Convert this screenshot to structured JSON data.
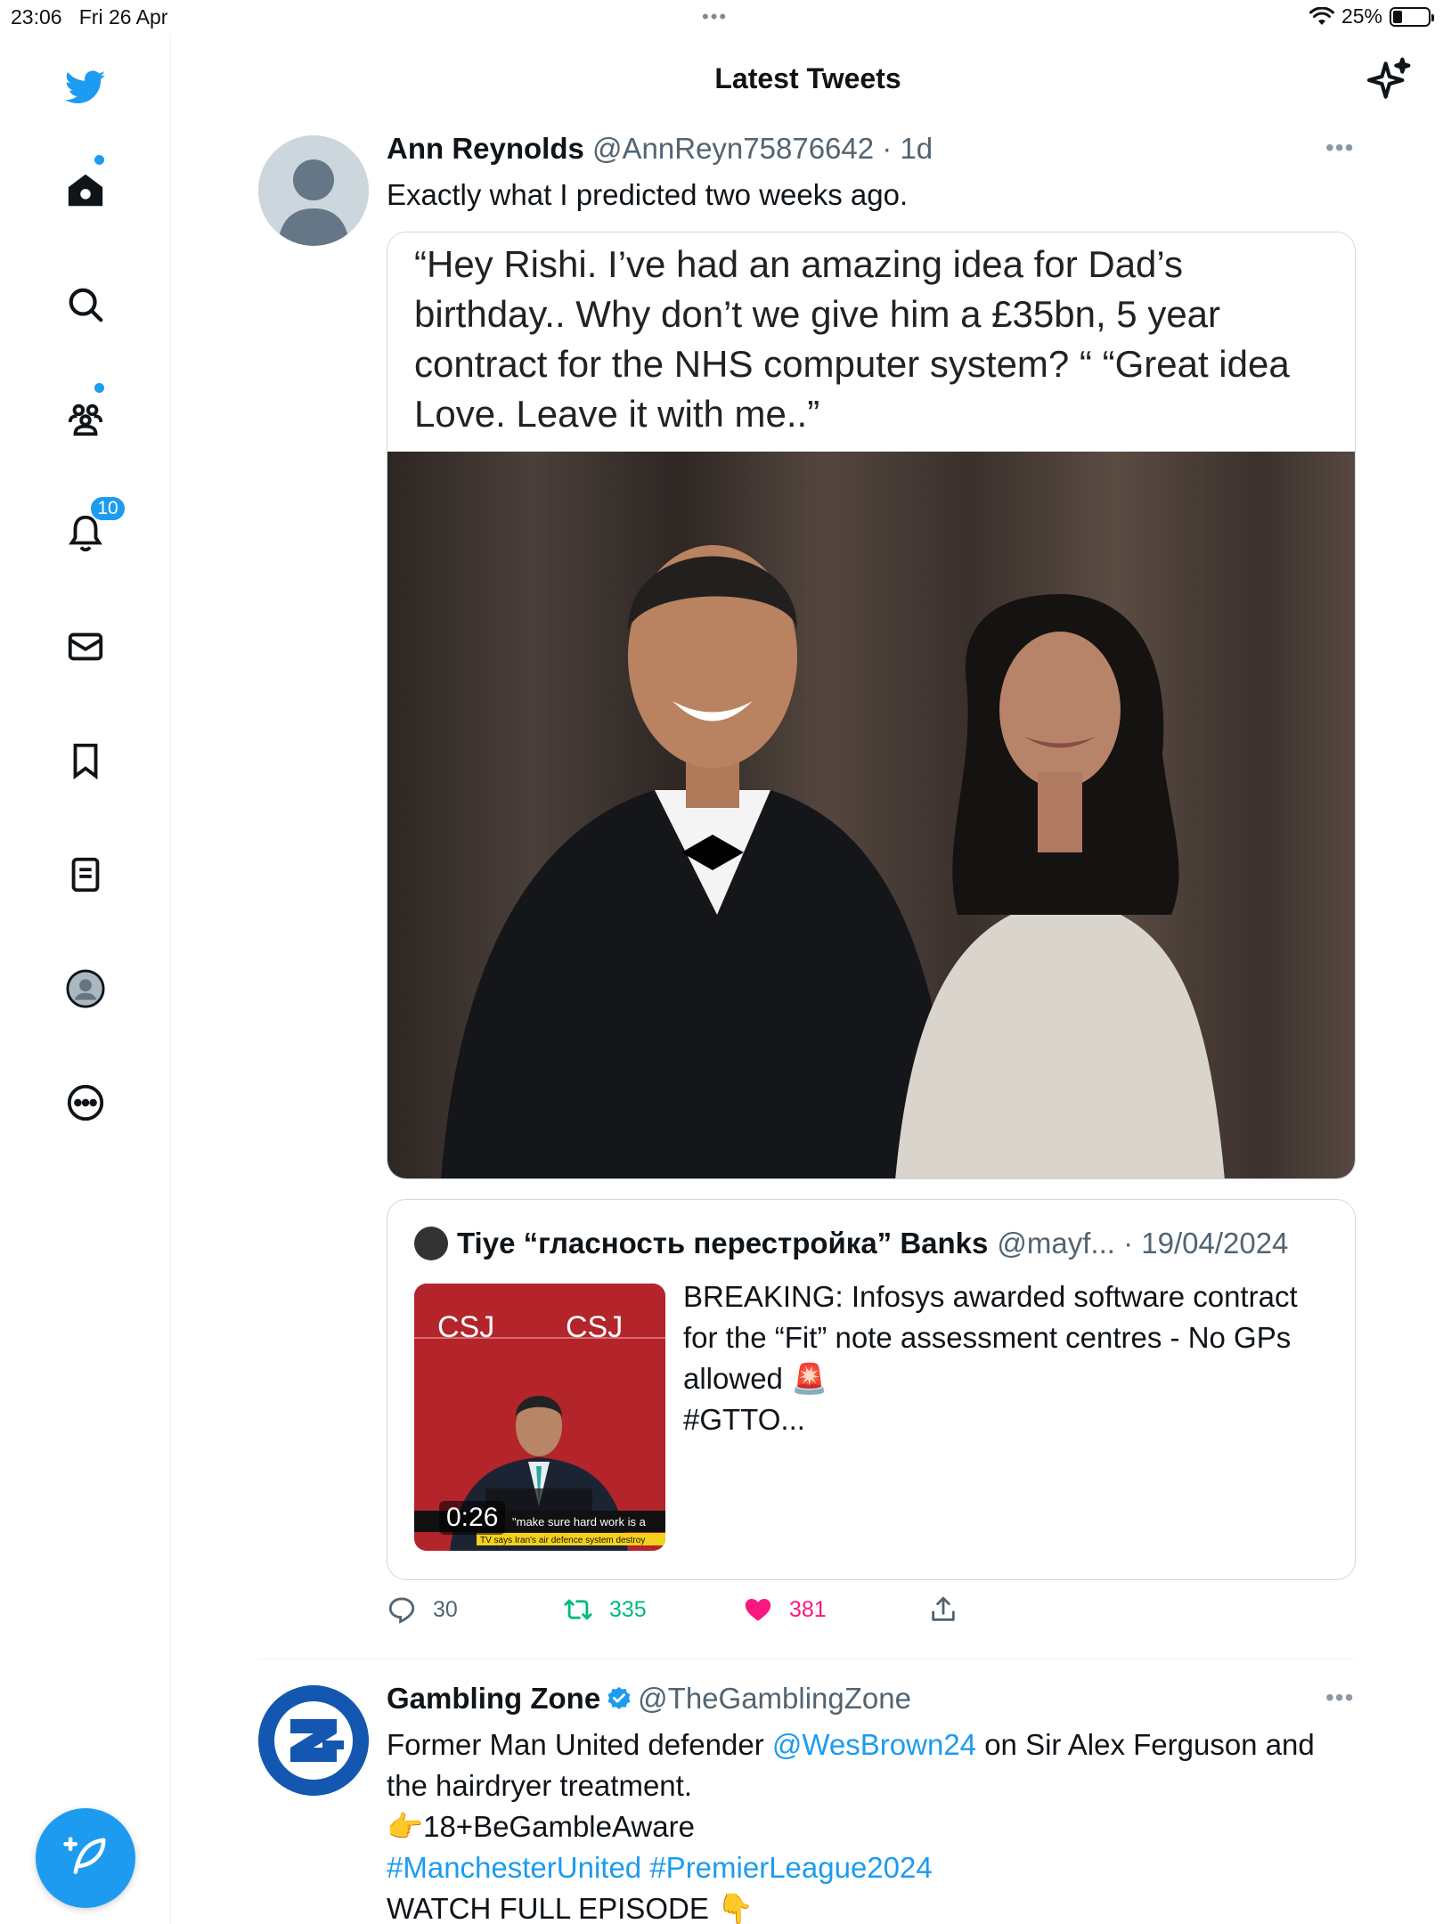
{
  "status_bar": {
    "time": "23:06",
    "date": "Fri 26 Apr",
    "dots": "•••",
    "battery": "25%",
    "battery_level": 0.25
  },
  "header": {
    "title": "Latest Tweets"
  },
  "sidebar": {
    "notifications_badge": "10",
    "items": [
      "twitter-logo",
      "home-icon",
      "search-icon",
      "communities-icon",
      "notifications-icon",
      "messages-icon",
      "bookmarks-icon",
      "lists-icon",
      "profile-icon",
      "more-icon"
    ]
  },
  "tweet1": {
    "name": "Ann Reynolds",
    "handle": "@AnnReyn75876642",
    "separator": " · ",
    "time": "1d",
    "text": "Exactly what I predicted two weeks ago.",
    "media_caption": "“Hey Rishi. I’ve had an amazing idea for Dad’s birthday.. Why don’t we give him a £35bn, 5 year contract for the NHS computer system? “ “Great idea Love. Leave it with me..”",
    "quote": {
      "name": "Tiye “гласность перестройка” Banks",
      "handle": "@mayf...",
      "separator": " · ",
      "date": "19/04/2024",
      "text_line1": "BREAKING: Infosys awarded software contract for the “Fit” note assessment centres - No GPs allowed 🚨",
      "text_line2": "#GTTO...",
      "video_duration": "0:26"
    },
    "actions": {
      "replies": "30",
      "retweets": "335",
      "likes": "381"
    },
    "colors": {
      "retweet": "#00ba7c",
      "like": "#f91880"
    }
  },
  "tweet2": {
    "name": "Gambling Zone",
    "handle": "@TheGamblingZone",
    "text_part1": "Former Man United defender ",
    "mention": "@WesBrown24",
    "text_part2": " on Sir Alex Ferguson and the hairdryer treatment.",
    "line2": "👉18+BeGambleAware",
    "hashtags": "#ManchesterUnited #PremierLeague2024",
    "line4": "WATCH FULL EPISODE 👇"
  },
  "colors": {
    "accent": "#1d9bf0",
    "text": "#0f1419",
    "secondary": "#536471"
  }
}
